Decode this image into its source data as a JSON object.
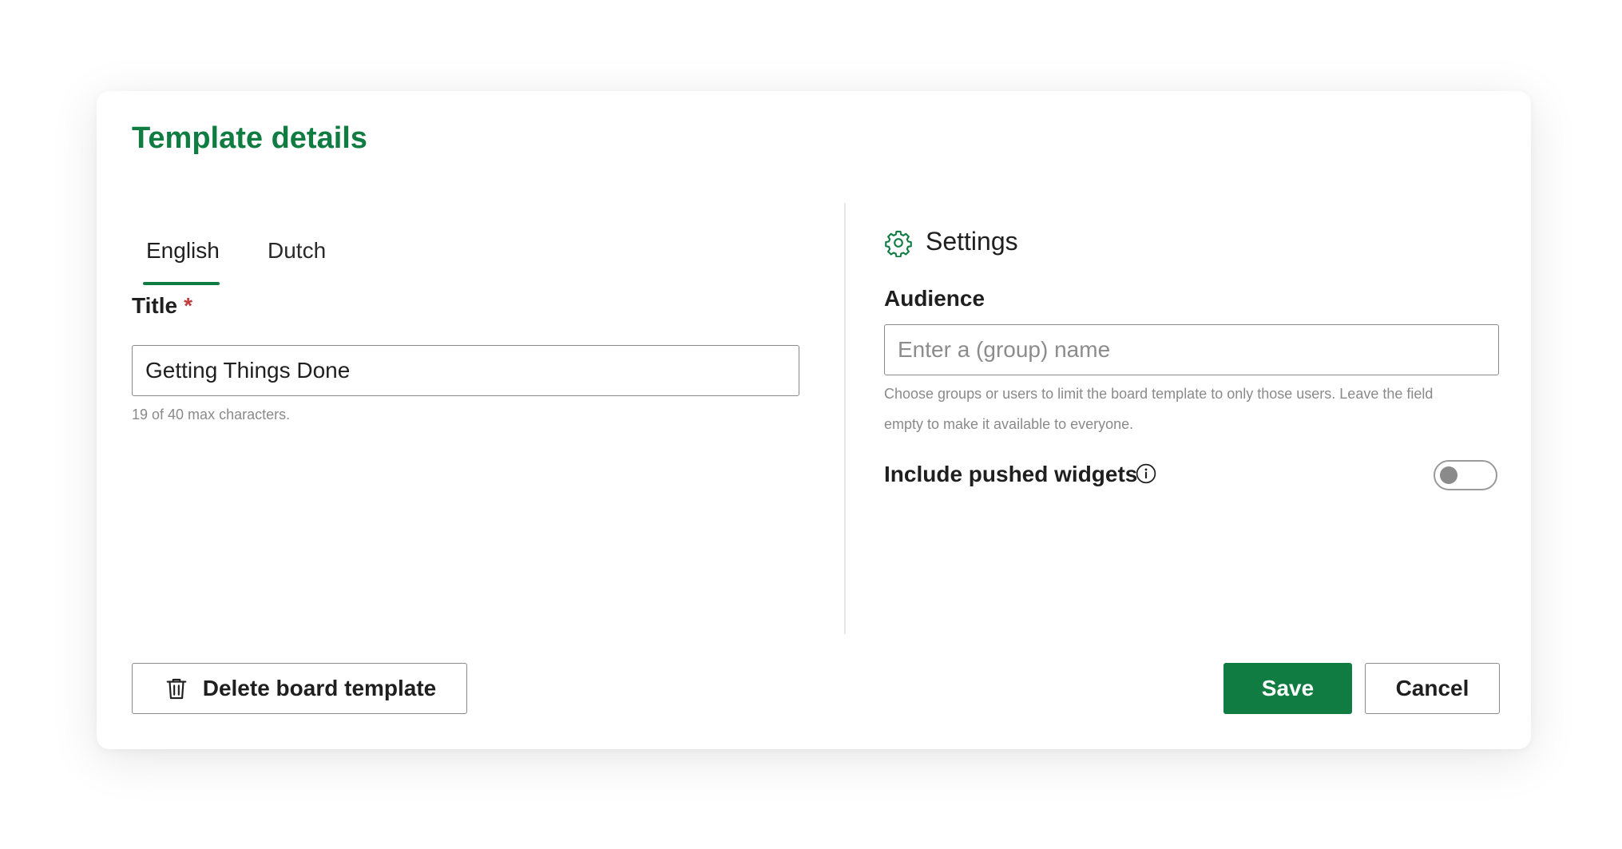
{
  "dialog": {
    "title": "Template details"
  },
  "tabs": [
    {
      "label": "English",
      "active": true
    },
    {
      "label": "Dutch",
      "active": false
    }
  ],
  "title_field": {
    "label": "Title",
    "required_marker": "*",
    "value": "Getting Things Done",
    "hint": "19 of 40 max characters."
  },
  "settings": {
    "heading": "Settings",
    "icon": "gear-icon",
    "audience": {
      "label": "Audience",
      "placeholder": "Enter a (group) name",
      "value": "",
      "hint_line1": "Choose groups or users to limit the board template to only those users. Leave the field",
      "hint_line2": "empty to make it available to everyone."
    },
    "pushed_widgets": {
      "label": "Include pushed widgets",
      "info_icon": "info-icon",
      "enabled": false
    }
  },
  "footer": {
    "delete_label": "Delete board template",
    "delete_icon": "trash-icon",
    "save_label": "Save",
    "cancel_label": "Cancel"
  },
  "colors": {
    "accent": "#107c41",
    "required": "#c43b3b",
    "hint_text": "#8a8a8a"
  }
}
